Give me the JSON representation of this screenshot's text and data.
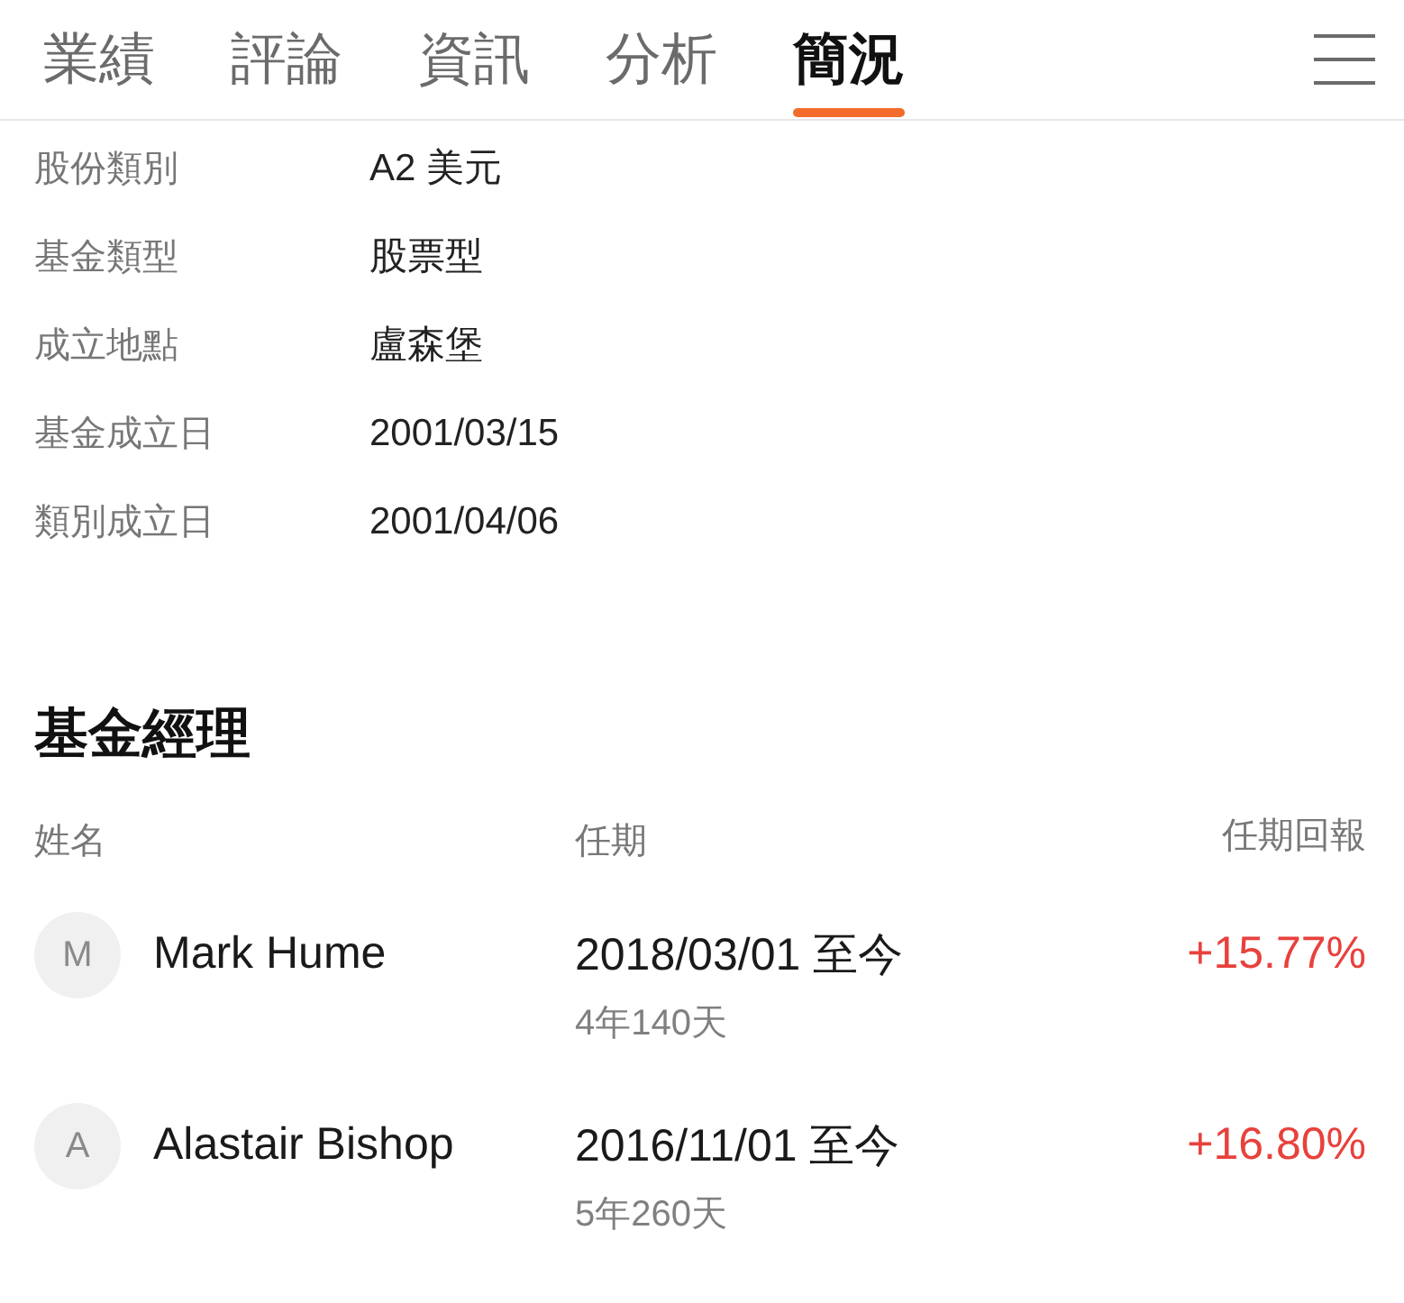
{
  "tabs": [
    {
      "label": "業績",
      "selected": false
    },
    {
      "label": "評論",
      "selected": false
    },
    {
      "label": "資訊",
      "selected": false
    },
    {
      "label": "分析",
      "selected": false
    },
    {
      "label": "簡況",
      "selected": true
    }
  ],
  "info": [
    {
      "label": "股份類別",
      "value": "A2 美元"
    },
    {
      "label": "基金類型",
      "value": "股票型"
    },
    {
      "label": "成立地點",
      "value": "盧森堡"
    },
    {
      "label": "基金成立日",
      "value": "2001/03/15"
    },
    {
      "label": "類別成立日",
      "value": "2001/04/06"
    }
  ],
  "managers": {
    "title": "基金經理",
    "columns": [
      "姓名",
      "任期",
      "任期回報"
    ],
    "rows": [
      {
        "initial": "M",
        "name": "Mark Hume",
        "period": "2018/03/01 至今",
        "duration": "4年140天",
        "return": "+15.77%"
      },
      {
        "initial": "A",
        "name": "Alastair Bishop",
        "period": "2016/11/01 至今",
        "duration": "5年260天",
        "return": "+16.80%"
      }
    ]
  }
}
